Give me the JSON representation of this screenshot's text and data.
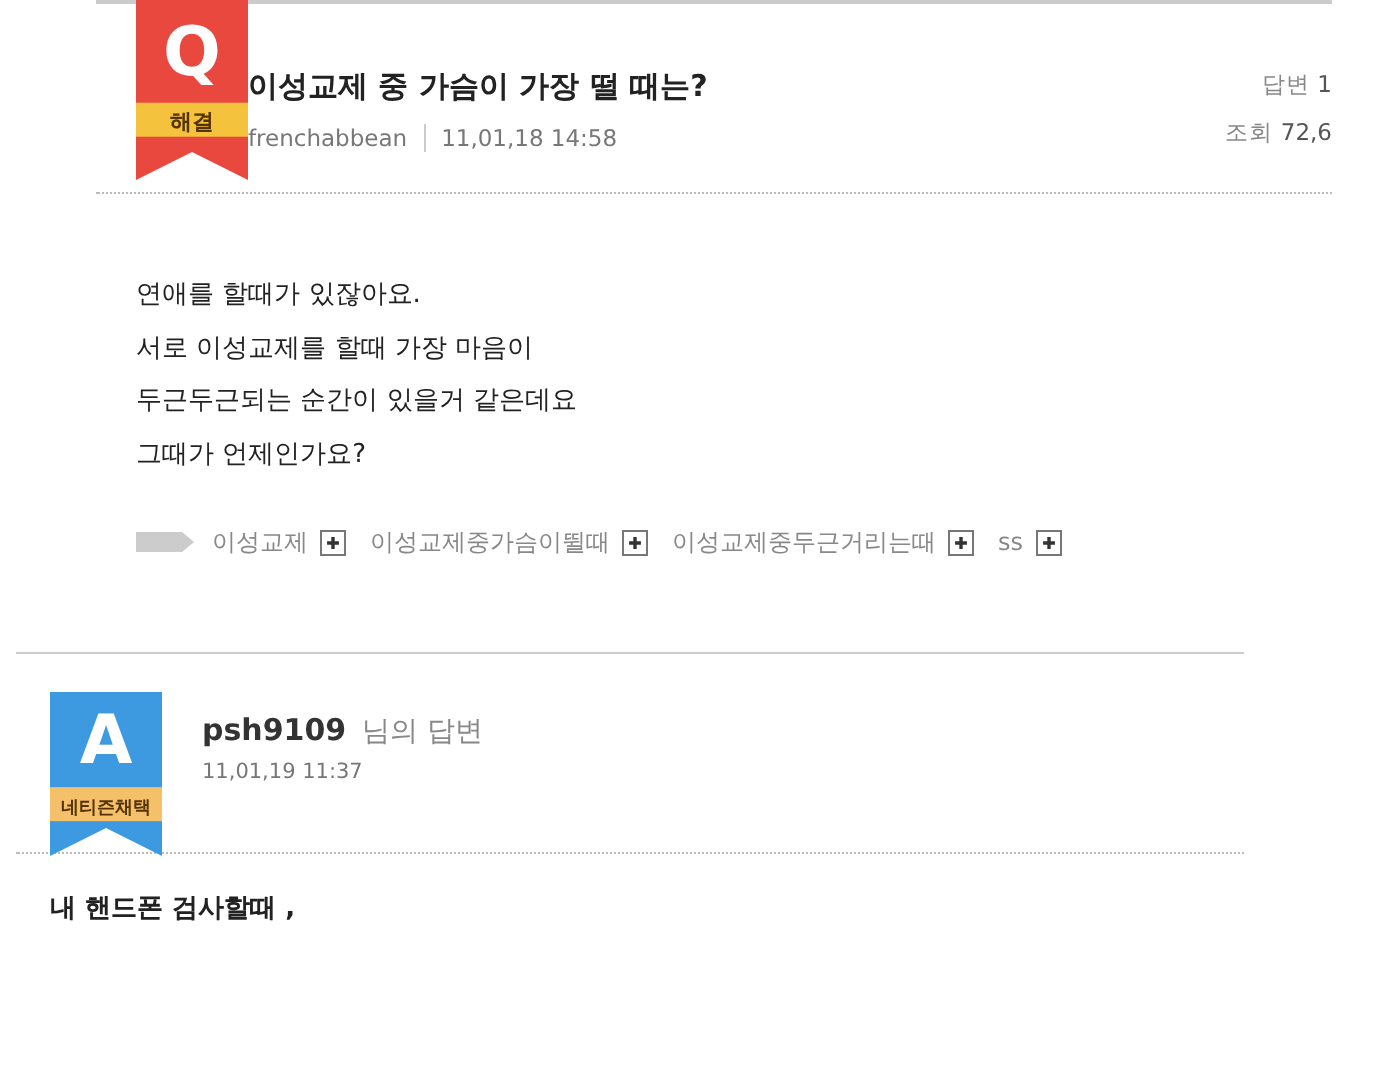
{
  "question": {
    "badge_letter": "Q",
    "badge_label": "해결",
    "title": "이성교제 중 가슴이 가장 떨 때는?",
    "author": "frenchabbean",
    "date": "11,01,18 14:58",
    "stats": [
      {
        "label": "답변",
        "value": "1"
      },
      {
        "label": "조회",
        "value": "72,6"
      }
    ],
    "body": [
      "연애를 할때가 있잖아요.",
      "서로 이성교제를 할때 가장 마음이",
      "두근두근되는 순간이 있을거 같은데요",
      "그때가 언제인가요?"
    ],
    "tags": [
      "이성교제",
      "이성교제중가슴이뛸때",
      "이성교제중두근거리는때",
      "ss"
    ]
  },
  "answer": {
    "badge_letter": "A",
    "badge_label": "네티즌채택",
    "author": "psh9109",
    "suffix": "님의 답변",
    "date": "11,01,19 11:37",
    "body": "내 핸드폰 검사할때 ,"
  }
}
